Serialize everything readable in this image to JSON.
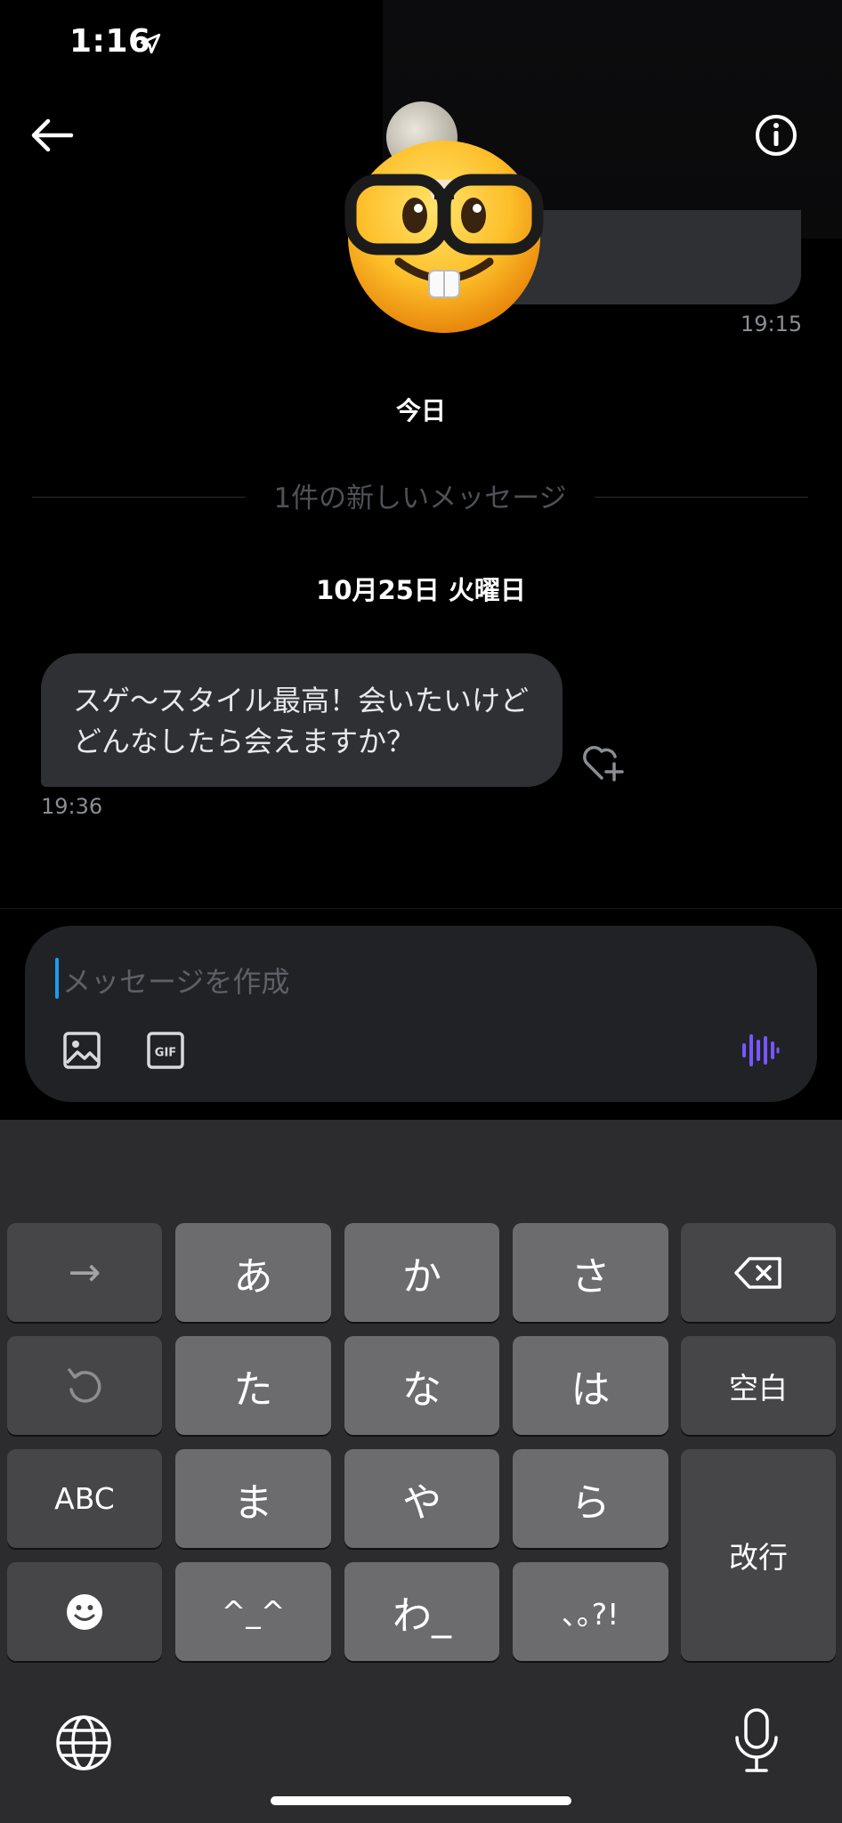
{
  "status_bar": {
    "time": "1:16"
  },
  "conversation": {
    "previous_timestamp": "19:15",
    "day_label": "今日",
    "new_messages_label": "1件の新しいメッセージ",
    "date_label": "10月25日 火曜日",
    "message": {
      "text": "スゲ〜スタイル最高！会いたいけどどんなしたら会えますか？",
      "timestamp": "19:36"
    }
  },
  "composer": {
    "placeholder": "メッセージを作成"
  },
  "keyboard": {
    "row1": [
      "→",
      "あ",
      "か",
      "さ",
      "⌫"
    ],
    "row2": [
      "↺",
      "た",
      "な",
      "は",
      "空白"
    ],
    "row3": [
      "ABC",
      "ま",
      "や",
      "ら"
    ],
    "row4": [
      "☺",
      "^_^",
      "わ_",
      "､｡?!"
    ],
    "return_label": "改行"
  },
  "colors": {
    "accent": "#1d9bf0",
    "voice": "#7856ff",
    "bubble": "#2f3033",
    "background": "#000000"
  }
}
